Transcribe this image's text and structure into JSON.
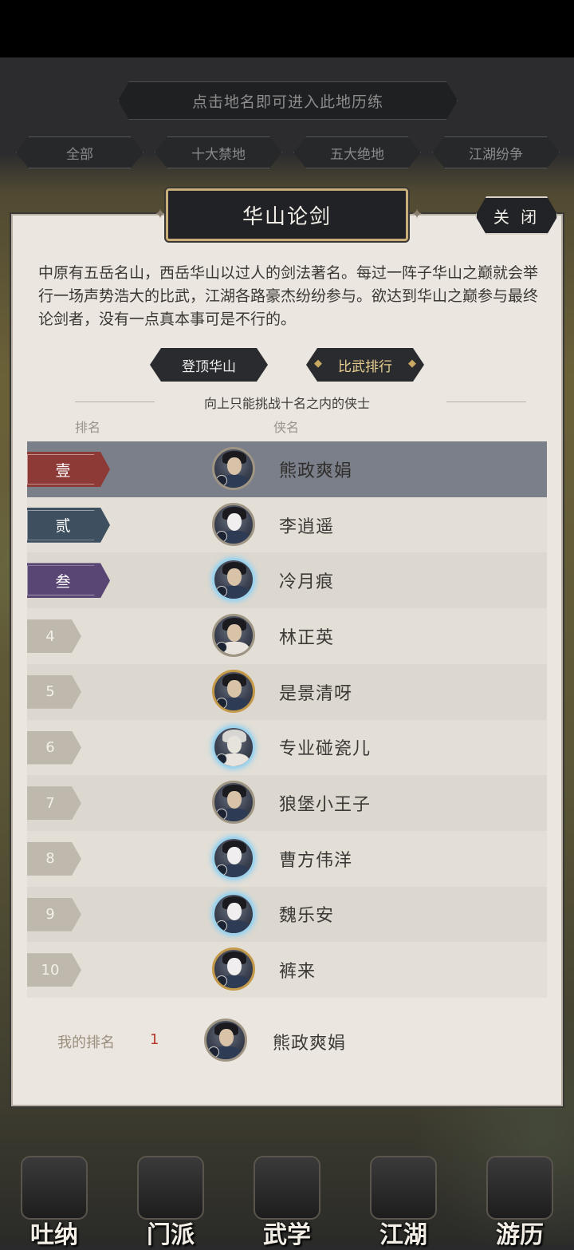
{
  "hint": "点击地名即可进入此地历练",
  "filters": [
    "全部",
    "十大禁地",
    "五大绝地",
    "江湖纷争"
  ],
  "panel": {
    "title": "华山论剑",
    "close_label": "关 闭",
    "description": "中原有五岳名山，西岳华山以过人的剑法著名。每过一阵子华山之巅就会举行一场声势浩大的比武，江湖各路豪杰纷纷参与。欲达到华山之巅参与最终论剑者，没有一点真本事可是不行的。",
    "buttons": {
      "climb": "登顶华山",
      "ranking": "比武排行"
    },
    "rule_text": "向上只能挑战十名之内的侠士",
    "columns": {
      "rank": "排名",
      "name": "侠名"
    }
  },
  "rankings": [
    {
      "rank": "壹",
      "name": "熊政爽娟",
      "ribbon_color": "#8d3a36",
      "frame": "plain",
      "face": "normal"
    },
    {
      "rank": "贰",
      "name": "李逍遥",
      "ribbon_color": "#3e4f60",
      "frame": "plain",
      "face": "mask"
    },
    {
      "rank": "叁",
      "name": "冷月痕",
      "ribbon_color": "#5a4674",
      "frame": "ice",
      "face": "normal"
    },
    {
      "rank": "4",
      "name": "林正英",
      "frame": "plain",
      "face": "female"
    },
    {
      "rank": "5",
      "name": "是景清呀",
      "frame": "gold",
      "face": "normal"
    },
    {
      "rank": "6",
      "name": "专业碰瓷儿",
      "frame": "ice",
      "face": "elder"
    },
    {
      "rank": "7",
      "name": "狼堡小王子",
      "frame": "plain",
      "face": "normal"
    },
    {
      "rank": "8",
      "name": "曹方伟洋",
      "frame": "ice",
      "face": "mask"
    },
    {
      "rank": "9",
      "name": "魏乐安",
      "frame": "ice",
      "face": "mask"
    },
    {
      "rank": "10",
      "name": "裤来",
      "frame": "gold",
      "face": "mask"
    }
  ],
  "my_rank": {
    "label": "我的排名",
    "value": "1",
    "name": "熊政爽娟"
  },
  "bottom_nav": [
    {
      "label": "吐纳",
      "icon": "meditation-icon"
    },
    {
      "label": "门派",
      "icon": "sect-banner-icon"
    },
    {
      "label": "武学",
      "icon": "martial-book-icon"
    },
    {
      "label": "江湖",
      "icon": "bamboo-hat-icon"
    },
    {
      "label": "游历",
      "icon": "horse-icon"
    }
  ]
}
